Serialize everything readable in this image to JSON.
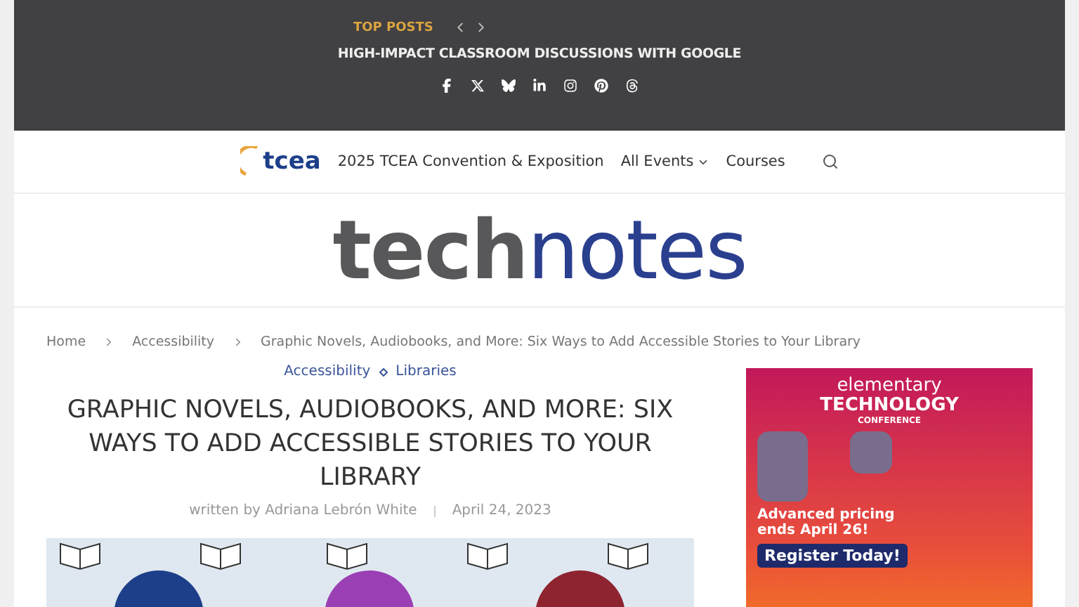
{
  "top_bar": {
    "label": "TOP POSTS",
    "headline": "HIGH-IMPACT CLASSROOM DISCUSSIONS WITH GOOGLE"
  },
  "nav": {
    "logo": "tcea",
    "items": [
      {
        "label": "2025 TCEA Convention & Exposition",
        "dropdown": false
      },
      {
        "label": "All Events",
        "dropdown": true
      },
      {
        "label": "Courses",
        "dropdown": false
      }
    ]
  },
  "site_logo": {
    "part_1": "tech",
    "part_2": "notes"
  },
  "breadcrumbs": [
    "Home",
    "Accessibility",
    "Graphic Novels, Audiobooks, and More: Six Ways to Add Accessible Stories to Your Library"
  ],
  "article": {
    "categories": [
      "Accessibility",
      "Libraries"
    ],
    "title": "GRAPHIC NOVELS, AUDIOBOOKS, AND MORE: SIX WAYS TO ADD ACCESSIBLE STORIES TO YOUR LIBRARY",
    "author": "written by Adriana Lebrón White",
    "date": "April 24, 2023"
  },
  "ad": {
    "line_1": "elementary",
    "line_2": "TECHNOLOGY",
    "line_3": "CONFERENCE",
    "offer": "Advanced pricing ends April 26!",
    "button": "Register Today!"
  }
}
